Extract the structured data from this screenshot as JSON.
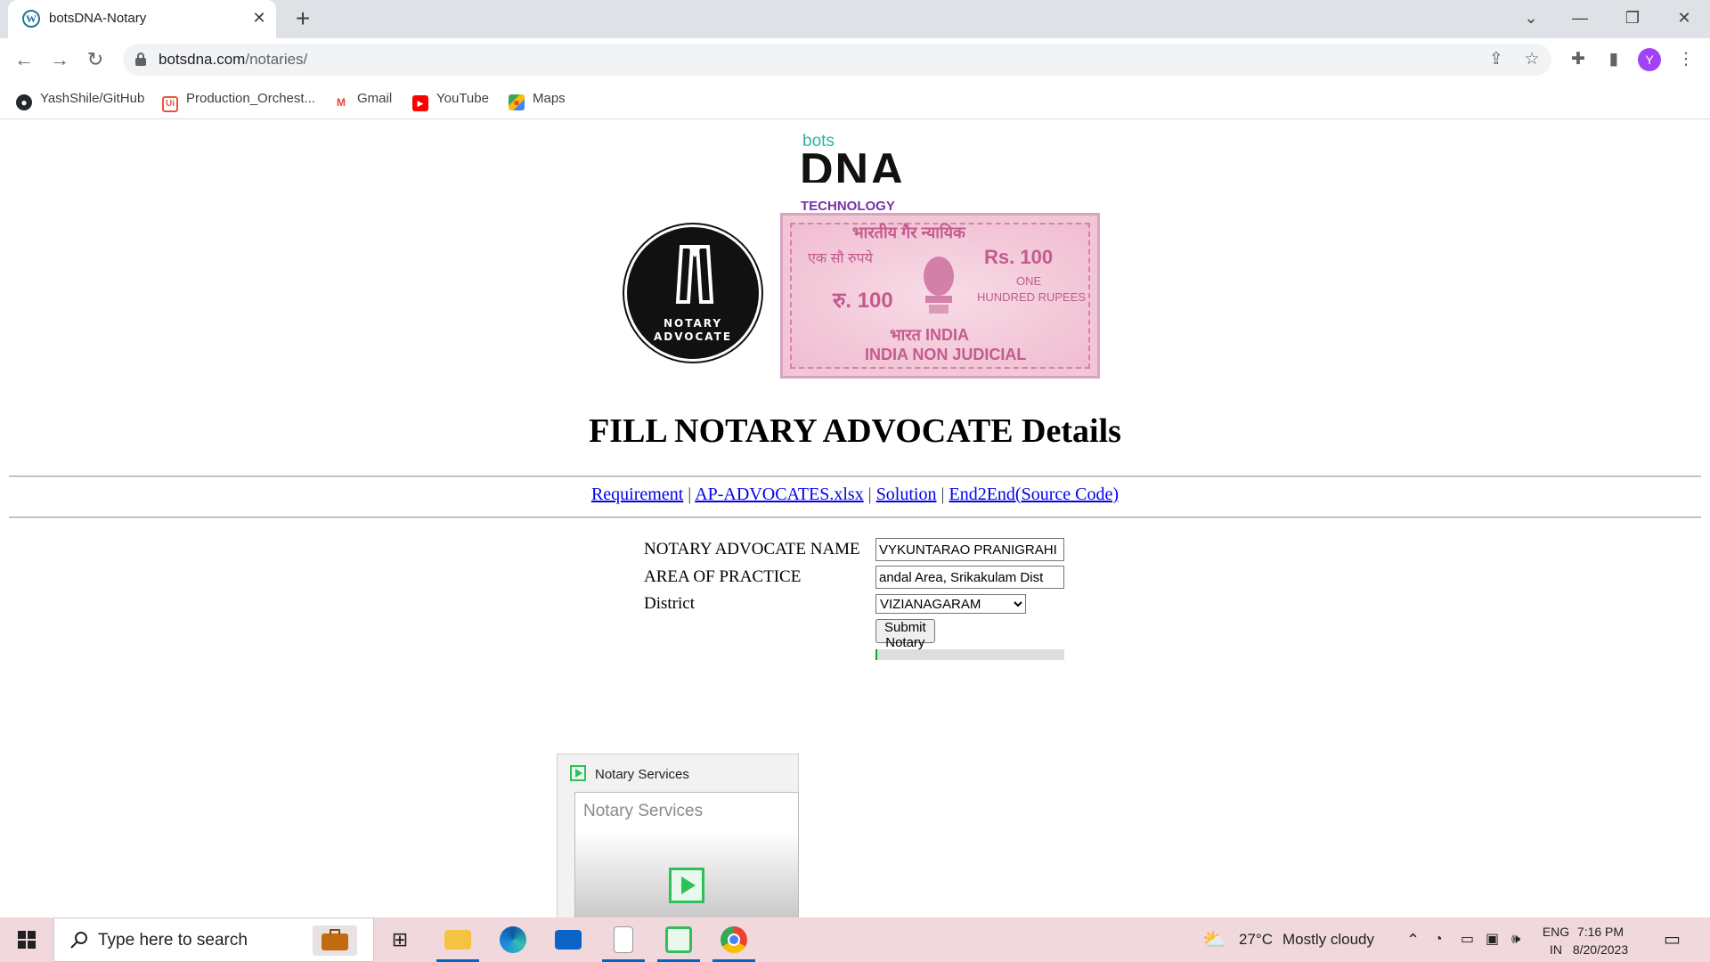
{
  "browser": {
    "tab_title": "botsDNA-Notary",
    "new_tab_label": "+",
    "url_domain": "botsdna.com",
    "url_path": "/notaries/",
    "profile_initial": "Y",
    "bookmarks": [
      "YashShile/GitHub",
      "Production_Orchest...",
      "Gmail",
      "YouTube",
      "Maps"
    ]
  },
  "page": {
    "logo": {
      "bots": "bots",
      "dna": "DNA",
      "technology": "TECHNOLOGY"
    },
    "seal": {
      "line1": "NOTARY",
      "line2": "ADVOCATE"
    },
    "stamp": {
      "hindi_top": "भारतीय गैर न्यायिक",
      "hindi_left": "एक सौ रुपये",
      "rs_right": "Rs. 100",
      "rs_left": "रु. 100",
      "one_hundred": "ONE",
      "hundred_rupees": "HUNDRED RUPEES",
      "bharat_india": "भारत INDIA",
      "non_judicial": "INDIA NON JUDICIAL"
    },
    "heading": "FILL NOTARY ADVOCATE Details",
    "links": [
      "Requirement",
      "AP-ADVOCATES.xlsx",
      "Solution",
      "End2End(Source Code)"
    ],
    "link_separator": "|",
    "form": {
      "name_label": "NOTARY ADVOCATE NAME",
      "name_value": "VYKUNTARAO PRANIGRAHI",
      "area_label": "AREA OF PRACTICE",
      "area_value": "andal Area, Srikakulam Dist",
      "district_label": "District",
      "district_value": "VIZIANAGARAM",
      "submit_label": "Submit Notary",
      "progress": 0.01
    }
  },
  "popup": {
    "title": "Notary Services",
    "preview_text": "Notary Services"
  },
  "taskbar": {
    "search_placeholder": "Type here to search",
    "weather_temp": "27°C",
    "weather_text": "Mostly cloudy",
    "lang_top": "ENG",
    "lang_bottom": "IN",
    "time": "7:16 PM",
    "date": "8/20/2023"
  },
  "colors": {
    "link": "#0000ee",
    "progress": "#06b025",
    "taskbar": "#f0d8dc",
    "accent": "#0067c0"
  }
}
